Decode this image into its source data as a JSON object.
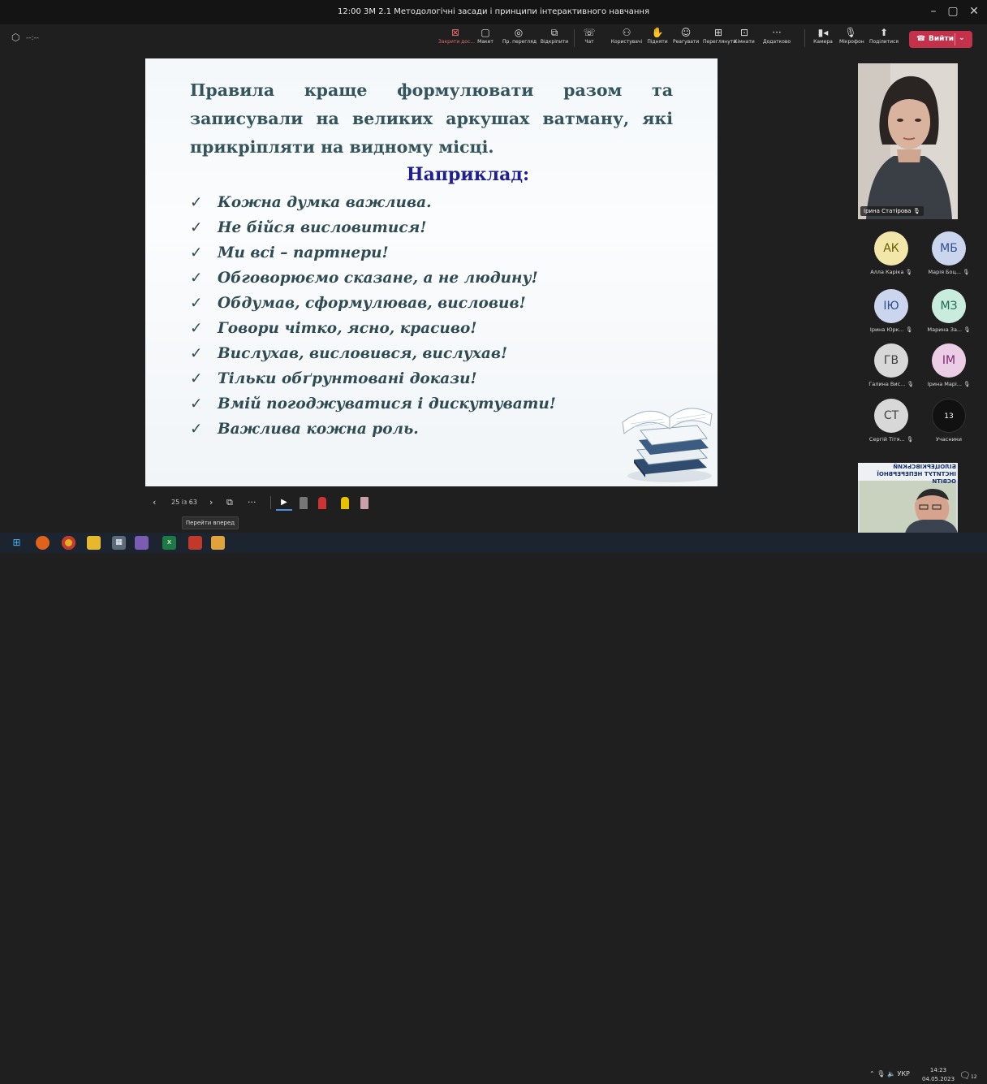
{
  "window": {
    "title": "12:00 3М 2.1 Методологічні засади і принципи інтерактивного навчання"
  },
  "toolbar": {
    "timer": "--:--",
    "buttons": [
      {
        "label": "Закрити дос...",
        "icon": "stop-share-icon",
        "glyph": "⊠"
      },
      {
        "label": "Макет",
        "icon": "layout-icon",
        "glyph": "▢"
      },
      {
        "label": "Пр. перегляд",
        "icon": "eye-icon",
        "glyph": "◎"
      },
      {
        "label": "Відкріпити",
        "icon": "unpin-icon",
        "glyph": "⧉"
      },
      {
        "label": "Чат",
        "icon": "chat-icon",
        "glyph": "☏"
      },
      {
        "label": "Користувачі",
        "icon": "people-icon",
        "glyph": "⚇"
      },
      {
        "label": "Підняти",
        "icon": "raise-hand-icon",
        "glyph": "✋"
      },
      {
        "label": "Реагувати",
        "icon": "react-icon",
        "glyph": "☺"
      },
      {
        "label": "Переглянути",
        "icon": "view-grid-icon",
        "glyph": "⊞"
      },
      {
        "label": "Кімнати",
        "icon": "rooms-icon",
        "glyph": "⊡"
      },
      {
        "label": "Додатково",
        "icon": "more-icon",
        "glyph": "···"
      },
      {
        "label": "Камера",
        "icon": "camera-icon",
        "glyph": "▮◂"
      },
      {
        "label": "Мікрофон",
        "icon": "microphone-icon",
        "glyph": "🎙"
      },
      {
        "label": "Поділитися",
        "icon": "share-icon",
        "glyph": "⬆"
      }
    ],
    "leave_label": "Вийти"
  },
  "slide": {
    "heading": "Правила краще формулювати разом та записували на великих аркушах ватману, які прикріпляти на видному місці.",
    "subheading": "Наприклад:",
    "check": "✓",
    "rules": [
      "Кожна думка важлива.",
      "Не бійся висловитися!",
      "Ми всі – партнери!",
      "Обговорюємо сказане, а не людину!",
      "Обдумав, сформулював, висловив!",
      "Говори чітко, ясно, красиво!",
      "Вислухав, висловився, вислухав!",
      "Тільки обґрунтовані докази!",
      "Вмій погоджуватися і дискутувати!",
      "Важлива кожна роль."
    ]
  },
  "presentation_controls": {
    "page": "25 із 63",
    "tooltip": "Перейти вперед"
  },
  "speaker": {
    "name": "Ірина Статірова"
  },
  "participants": [
    {
      "initials": "АК",
      "name": "Алла Каріка",
      "bg": "#f2e6a8",
      "fg": "#6b5a00"
    },
    {
      "initials": "МБ",
      "name": "Марія Боц...",
      "bg": "#cbd6ee",
      "fg": "#2f4f8a"
    },
    {
      "initials": "ІЮ",
      "name": "Ірина Юрк...",
      "bg": "#cbd6ee",
      "fg": "#2f4f8a"
    },
    {
      "initials": "МЗ",
      "name": "Марина За...",
      "bg": "#c9ecdf",
      "fg": "#1f6b52"
    },
    {
      "initials": "ГВ",
      "name": "Галина Вис...",
      "bg": "#d8d8d8",
      "fg": "#404040"
    },
    {
      "initials": "ІМ",
      "name": "Ірина Марі...",
      "bg": "#eccde6",
      "fg": "#7a2a6e"
    },
    {
      "initials": "СТ",
      "name": "Сергій Тітя...",
      "bg": "#d8d8d8",
      "fg": "#404040"
    },
    {
      "initials": "13",
      "name": "Учасники",
      "bg": "#111111",
      "fg": "#ffffff"
    }
  ],
  "screenshare_banner": "БІЛОЦЕРКІВСЬКИЙ ІНСТИТУТ НЕПЕРЕРВНОЇ ОСВІТИ",
  "taskbar": {
    "lang": "УКР",
    "time": "14:23",
    "date": "04.05.2023",
    "notifications": "12"
  }
}
